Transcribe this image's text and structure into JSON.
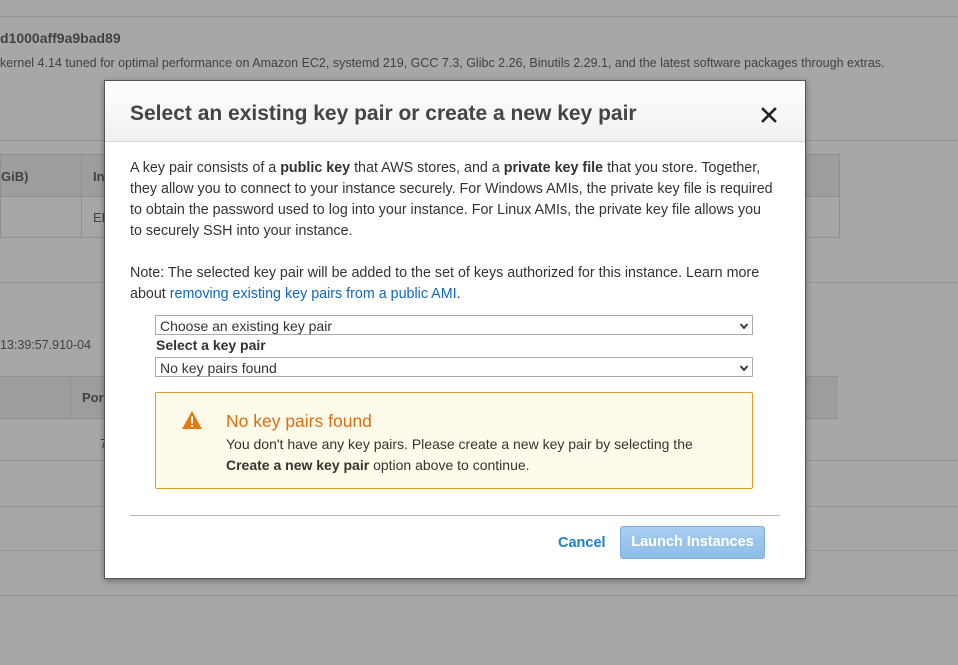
{
  "background": {
    "ami_id": "d1000aff9a9bad89",
    "ami_description": "kernel 4.14 tuned for optimal performance on Amazon EC2, systemd 219, GCC 7.3, Glibc 2.26, Binutils 2.29.1, and the latest software packages through extras.",
    "table_head_fragment_1": "GiB)",
    "table_head_fragment_2": "In",
    "table_cell_fragment": "EE",
    "timestamp_fragment": "13:39:57.910-04",
    "ports_head_fragment": "Por",
    "row_digit": "7"
  },
  "modal": {
    "title": "Select an existing key pair or create a new key pair",
    "close_icon": "close-icon",
    "para1": {
      "t1": "A key pair consists of a ",
      "b1": "public key",
      "t2": " that AWS stores, and a ",
      "b2": "private key file",
      "t3": " that you store. Together, they allow you to connect to your instance securely. For Windows AMIs, the private key file is required to obtain the password used to log into your instance. For Linux AMIs, the private key file allows you to securely SSH into your instance."
    },
    "para2": {
      "text": "Note: The selected key pair will be added to the set of keys authorized for this instance. Learn more about ",
      "link": "removing existing key pairs from a public AMI",
      "end": "."
    },
    "action_select": {
      "value": "Choose an existing key pair"
    },
    "key_pair_label": "Select a key pair",
    "key_pair_select": {
      "value": "No key pairs found"
    },
    "alert": {
      "icon": "warning-icon",
      "title": "No key pairs found",
      "text1": "You don't have any key pairs. Please create a new key pair by selecting the ",
      "bold": "Create a new key pair",
      "text2": " option above to continue.",
      "accent_color": "#dd6b10"
    },
    "cancel_label": "Cancel",
    "launch_label": "Launch Instances",
    "launch_color": "#9cc6ec"
  }
}
